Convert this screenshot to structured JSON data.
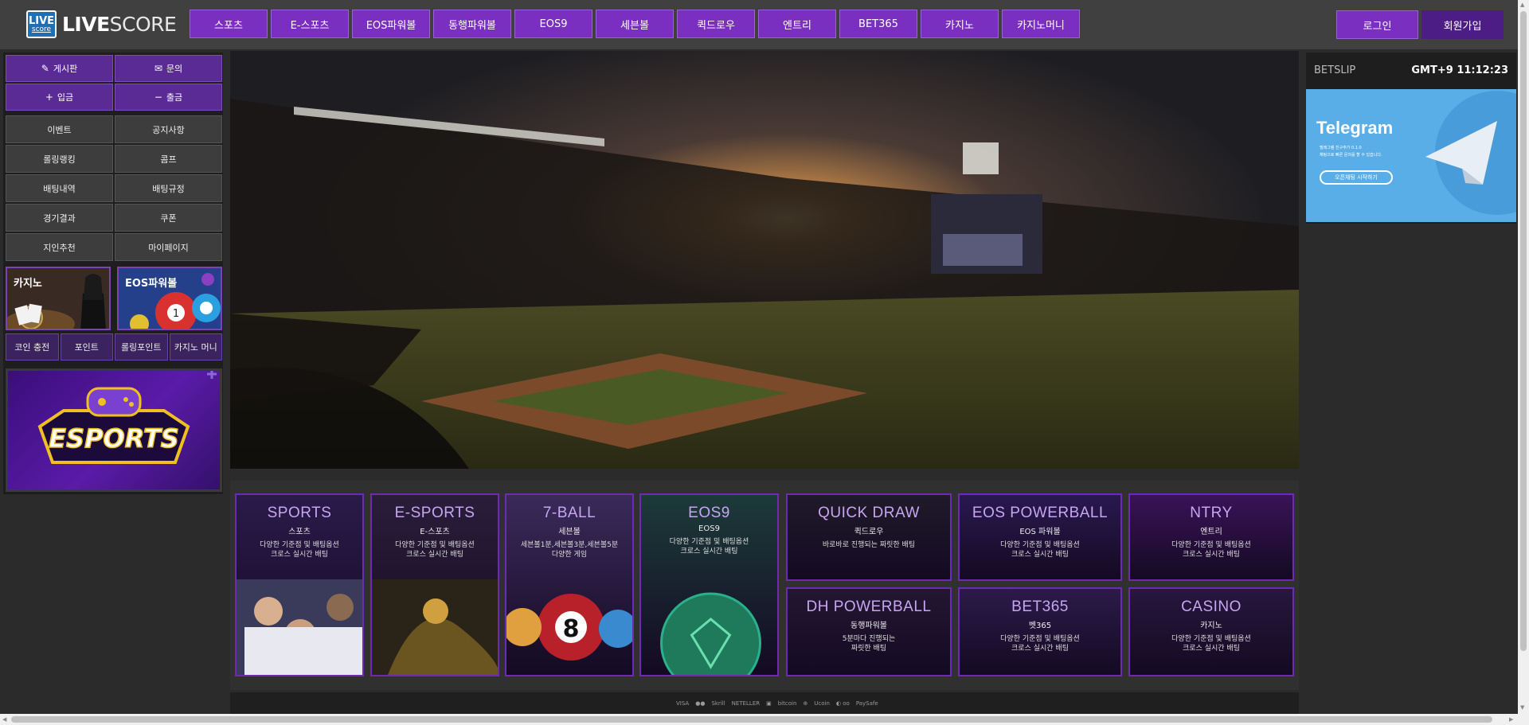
{
  "logo": {
    "badge_top": "LIVE",
    "badge_bottom": "score",
    "word_bold": "LIVE",
    "word_light": "SCORE"
  },
  "nav": [
    "스포츠",
    "E-스포츠",
    "EOS파워볼",
    "동행파워볼",
    "EOS9",
    "세븐볼",
    "퀵드로우",
    "엔트리",
    "BET365",
    "카지노",
    "카지노머니"
  ],
  "auth": {
    "login": "로그인",
    "join": "회원가입"
  },
  "left_menu": {
    "primary": [
      {
        "label": "게시판",
        "icon": "edit-icon"
      },
      {
        "label": "문의",
        "icon": "chat-icon"
      },
      {
        "label": "입금",
        "icon": "plus-icon"
      },
      {
        "label": "출금",
        "icon": "minus-icon"
      }
    ],
    "secondary": [
      "이벤트",
      "공지사항",
      "롤링랭킹",
      "콤프",
      "배팅내역",
      "배팅규정",
      "경기결과",
      "쿠폰",
      "지인추천",
      "마이페이지"
    ],
    "promos": [
      "카지노",
      "EOS파워볼"
    ],
    "coin_row": [
      "코인 충전",
      "포인트",
      "롤링포인트",
      "카지노 머니"
    ],
    "esports_banner": "ESPORTS"
  },
  "games": [
    {
      "title": "SPORTS",
      "sub": "스포츠",
      "desc": "다양한 기준점 및 배팅옵션\n크로스 실시간 배팅",
      "bg": "#2a1a4a"
    },
    {
      "title": "E-SPORTS",
      "sub": "E-스포츠",
      "desc": "다양한 기준점 및 배팅옵션\n크로스 실시간 배팅",
      "bg": "#2a1d3a"
    },
    {
      "title": "7-BALL",
      "sub": "세븐볼",
      "desc": "세븐볼1분,세븐볼3분,세븐볼5분\n다양한 게임",
      "bg": "#3a2a5a"
    },
    {
      "title": "EOS9",
      "sub": "EOS9",
      "desc": "다양한 기준점 및 배팅옵션\n크로스 실시간 배팅",
      "bg": "#1c3a3a"
    },
    {
      "title": "QUICK DRAW",
      "sub": "퀵드로우",
      "desc": "바로바로 진행되는 짜릿한 배팅",
      "bg": "#1f1a2a"
    },
    {
      "title": "EOS POWERBALL",
      "sub": "EOS 파워볼",
      "desc": "다양한 기준점 및 배팅옵션\n크로스 실시간 배팅",
      "bg": "#2a1850"
    },
    {
      "title": "NTRY",
      "sub": "엔트리",
      "desc": "다양한 기준점 및 배팅옵션\n크로스 실시간 배팅",
      "bg": "#3a1258"
    },
    {
      "title": "DH POWERBALL",
      "sub": "동행파워볼",
      "desc": "5분마다 진행되는\n짜릿한 배팅",
      "bg": "#231632"
    },
    {
      "title": "BET365",
      "sub": "벳365",
      "desc": "다양한 기준점 및 배팅옵션\n크로스 실시간 배팅",
      "bg": "#2c1a4a"
    },
    {
      "title": "CASINO",
      "sub": "카지노",
      "desc": "다양한 기준점 및 배팅옵션\n크로스 실시간 배팅",
      "bg": "#28163e"
    }
  ],
  "footer_payments": [
    "VISA",
    "●●",
    "Skrill",
    "NETELLER",
    "▣",
    "bitcoin",
    "⊕",
    "Ucoin",
    "◐ oo",
    "PaySafe"
  ],
  "betslip": {
    "label": "BETSLIP",
    "time": "GMT+9 11:12:23"
  },
  "telegram": {
    "title": "Telegram",
    "line1": "텔레그램 친구추가 0.1.0",
    "line2": "채팅으로 빠른 문의를 할 수 있습니다.",
    "button": "오픈채팅 시작하기"
  }
}
